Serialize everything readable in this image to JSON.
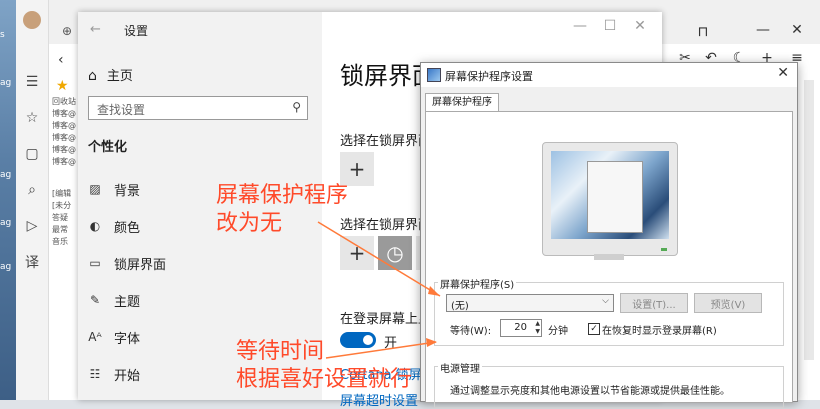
{
  "desktop": {
    "labels": [
      "s",
      "ag",
      "ag",
      "ag",
      "ag"
    ]
  },
  "browser": {
    "sidebar_icons": [
      "list-icon",
      "star-icon",
      "book-icon",
      "search-icon",
      "play-icon",
      "translate-icon"
    ],
    "favorite_items": [
      "回收站",
      "博客@",
      "博客@",
      "博客@",
      "博客@",
      "博客@",
      "[编辑",
      "[未分",
      "答疑",
      "最常",
      "音乐"
    ]
  },
  "settings": {
    "window_title": "设置",
    "home_label": "主页",
    "search_placeholder": "查找设置",
    "section_title": "个性化",
    "nav_items": [
      {
        "label": "背景",
        "icon": "image-icon"
      },
      {
        "label": "颜色",
        "icon": "palette-icon"
      },
      {
        "label": "锁屏界面",
        "icon": "lockscreen-icon"
      },
      {
        "label": "主题",
        "icon": "theme-icon"
      },
      {
        "label": "字体",
        "icon": "font-icon"
      },
      {
        "label": "开始",
        "icon": "start-icon"
      }
    ],
    "main_title": "锁屏界面",
    "choose_app_1": "选择在锁屏界面",
    "choose_app_2": "选择在锁屏界面",
    "login_screen_text": "在登录屏幕上显",
    "toggle_label": "开",
    "link_cortana": "Cortana 锁屏界",
    "link_screen_timeout": "屏幕超时设置"
  },
  "dialog": {
    "title": "屏幕保护程序设置",
    "tab": "屏幕保护程序",
    "group_label": "屏幕保护程序(S)",
    "combo_value": "(无)",
    "settings_button": "设置(T)...",
    "preview_button": "预览(V)",
    "wait_label": "等待(W):",
    "wait_value": "20",
    "minutes_label": "分钟",
    "resume_checkbox_label": "在恢复时显示登录屏幕(R)",
    "resume_checked": true,
    "power_group_label": "电源管理",
    "power_text": "通过调整显示亮度和其他电源设置以节省能源或提供最佳性能。"
  },
  "annotations": {
    "note1_line1": "屏幕保护程序",
    "note1_line2": "改为无",
    "note2_line1": "等待时间",
    "note2_line2": "根据喜好设置就行",
    "color": "#ff4a2a"
  }
}
